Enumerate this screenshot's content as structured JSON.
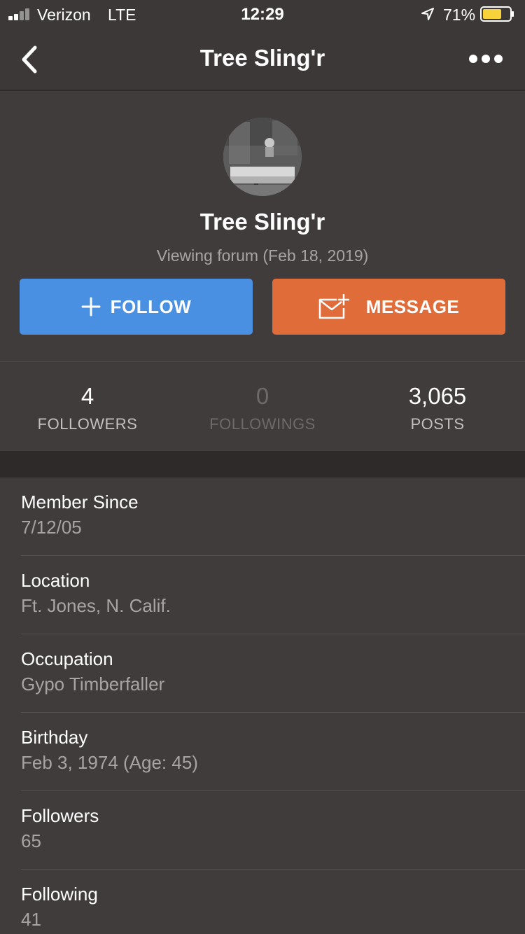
{
  "status_bar": {
    "carrier": "Verizon",
    "network": "LTE",
    "time": "12:29",
    "battery_percent": "71%",
    "battery_level": 0.71,
    "battery_color": "#f8d23a"
  },
  "nav": {
    "title": "Tree Sling'r",
    "back_icon": "chevron-left-icon",
    "more_icon": "more-horizontal-icon"
  },
  "profile": {
    "name": "Tree Sling'r",
    "status": "Viewing forum (Feb 18, 2019)",
    "follow_label": "FOLLOW",
    "message_label": "MESSAGE",
    "follow_color": "#4a90e2",
    "message_color": "#e06c3a"
  },
  "stats": [
    {
      "value": "4",
      "label": "FOLLOWERS"
    },
    {
      "value": "0",
      "label": "FOLLOWINGS"
    },
    {
      "value": "3,065",
      "label": "POSTS"
    }
  ],
  "info": [
    {
      "label": "Member Since",
      "value": "7/12/05"
    },
    {
      "label": "Location",
      "value": "Ft. Jones, N. Calif."
    },
    {
      "label": "Occupation",
      "value": "Gypo Timberfaller"
    },
    {
      "label": "Birthday",
      "value": "Feb 3, 1974 (Age: 45)"
    },
    {
      "label": "Followers",
      "value": "65"
    },
    {
      "label": "Following",
      "value": "41"
    }
  ]
}
